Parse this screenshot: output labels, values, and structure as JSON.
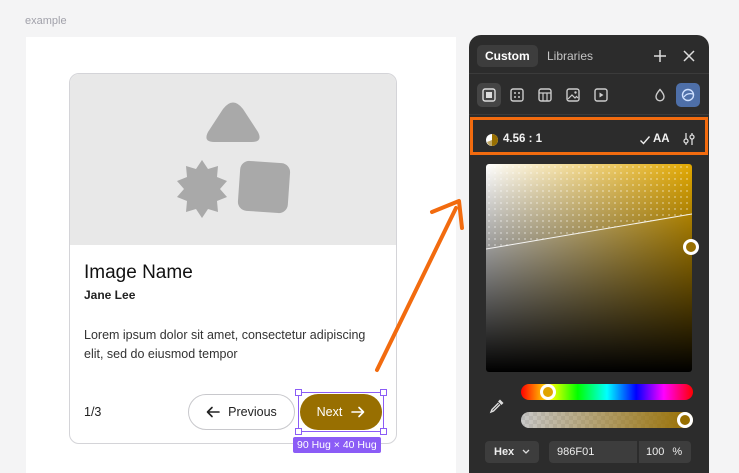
{
  "canvas": {
    "label": "example"
  },
  "card": {
    "title": "Image Name",
    "author": "Jane Lee",
    "description": "Lorem ipsum dolor sit amet, consectetur adipiscing elit, sed do eiusmod tempor",
    "pagination": "1/3",
    "prev_label": "Previous",
    "next_label": "Next",
    "selection_size": "90 Hug × 40 Hug"
  },
  "panel": {
    "tabs": [
      {
        "label": "Custom"
      },
      {
        "label": "Libraries"
      }
    ],
    "contrast": {
      "ratio": "4.56 : 1",
      "level": "AA"
    },
    "color": {
      "format": "Hex",
      "hex": "986F01",
      "alpha": "100",
      "alpha_unit": "%"
    }
  },
  "colors": {
    "accent": "#986f01",
    "selection": "#8b5cf6",
    "highlight": "#f26b0f",
    "panel_bg": "#2c2c2c"
  },
  "icons": [
    "plus-icon",
    "close-icon",
    "solid-fill-icon",
    "gradient-fill-icon",
    "pattern-fill-icon",
    "image-fill-icon",
    "video-fill-icon",
    "drop-icon",
    "contrast-icon",
    "check-icon",
    "sliders-icon",
    "eyedropper-icon",
    "chevron-down-icon",
    "arrow-left-icon",
    "arrow-right-icon"
  ]
}
